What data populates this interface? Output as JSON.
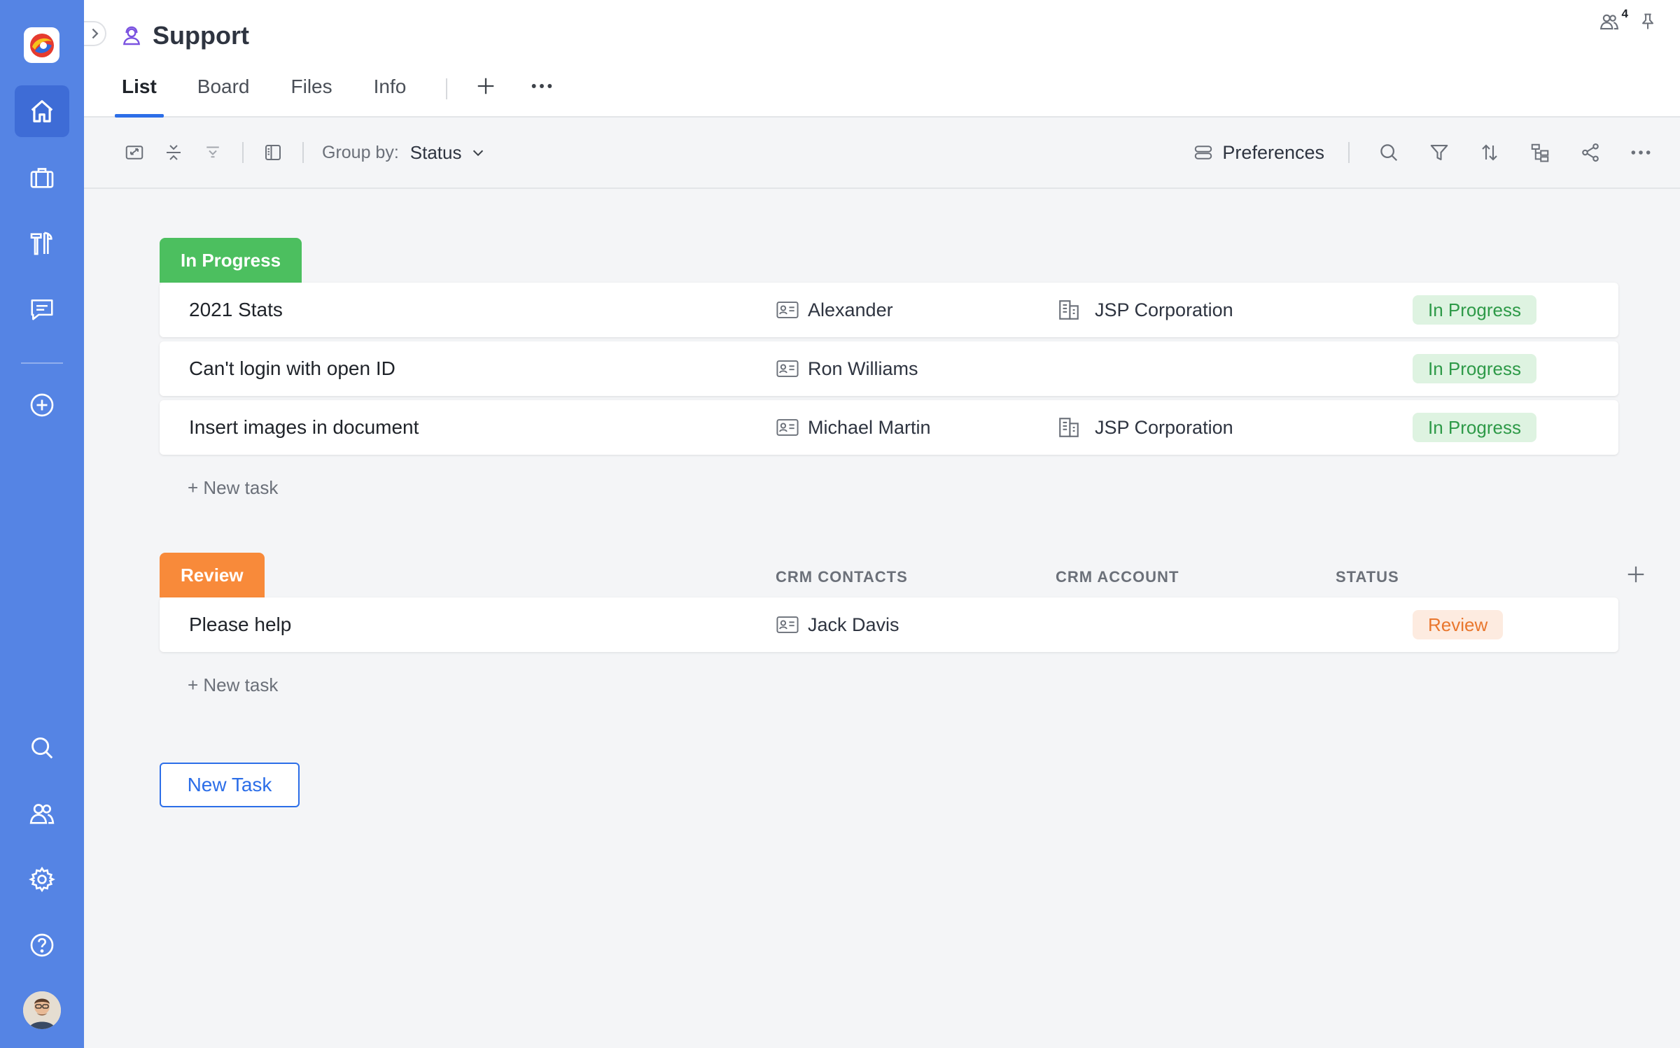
{
  "app": {
    "title": "Support",
    "tabs": [
      "List",
      "Board",
      "Files",
      "Info"
    ],
    "participants_count": "4"
  },
  "colors": {
    "rail": "#5584e4",
    "accent": "#2c6ee8",
    "in_progress": "#4cbf5f",
    "review": "#f88a3a"
  },
  "toolbar": {
    "groupby_label": "Group by:",
    "groupby_value": "Status",
    "preferences": "Preferences"
  },
  "groups": [
    {
      "label": "In Progress",
      "tasks": [
        {
          "name": "2021 Stats",
          "contact": "Alexander",
          "account": "JSP Corporation",
          "status": "In Progress"
        },
        {
          "name": "Can't login with open ID",
          "contact": "Ron Williams",
          "account": "",
          "status": "In Progress"
        },
        {
          "name": "Insert images in document",
          "contact": "Michael Martin",
          "account": "JSP Corporation",
          "status": "In Progress"
        }
      ],
      "new_task": "+ New task"
    },
    {
      "label": "Review",
      "columns": [
        "CRM CONTACTS",
        "CRM ACCOUNT",
        "STATUS"
      ],
      "tasks": [
        {
          "name": "Please help",
          "contact": "Jack Davis",
          "account": "",
          "status": "Review"
        }
      ],
      "new_task": "+ New task"
    }
  ],
  "new_task_button": "New Task",
  "icons": {
    "rail": [
      "home-icon",
      "briefcase-icon",
      "tools-icon",
      "chat-icon",
      "plus-circle-icon",
      "search-icon",
      "people-icon",
      "gear-icon",
      "help-icon"
    ],
    "toolbar": [
      "expand-icon",
      "collapse-all-icon",
      "filter-collapse-icon",
      "panel-icon",
      "preferences-icon",
      "search-icon",
      "filter-icon",
      "sort-icon",
      "hierarchy-icon",
      "share-icon",
      "more-icon"
    ]
  }
}
